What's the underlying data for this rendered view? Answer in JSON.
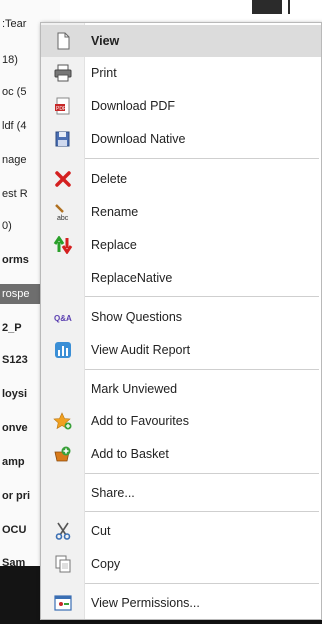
{
  "background": {
    "items": [
      {
        "text": ":Tear",
        "style": "normal"
      },
      {
        "text": "18)",
        "style": "normal"
      },
      {
        "text": "oc (5",
        "style": "normal"
      },
      {
        "text": "ldf (4",
        "style": "normal"
      },
      {
        "text": "nage",
        "style": "normal"
      },
      {
        "text": "est R",
        "style": "normal"
      },
      {
        "text": "0)",
        "style": "normal"
      },
      {
        "text": "orms",
        "style": "bold"
      },
      {
        "text": "rospe",
        "style": "selected"
      },
      {
        "text": "2_P",
        "style": "bold"
      },
      {
        "text": "S123",
        "style": "bold"
      },
      {
        "text": "loysi",
        "style": "bold"
      },
      {
        "text": "onve",
        "style": "bold"
      },
      {
        "text": "amp",
        "style": "bold"
      },
      {
        "text": "or pri",
        "style": "bold"
      },
      {
        "text": "OCU",
        "style": "bold"
      },
      {
        "text": "Sam",
        "style": "bold"
      }
    ]
  },
  "menu": {
    "items": [
      {
        "label": "View",
        "icon": "page-icon",
        "highlight": true
      },
      {
        "label": "Print",
        "icon": "printer-icon"
      },
      {
        "label": "Download PDF",
        "icon": "pdf-icon"
      },
      {
        "label": "Download Native",
        "icon": "save-icon"
      },
      {
        "label": "Delete",
        "icon": "delete-x-icon"
      },
      {
        "label": "Rename",
        "icon": "rename-abc-icon"
      },
      {
        "label": "Replace",
        "icon": "replace-arrows-icon"
      },
      {
        "label": "ReplaceNative",
        "icon": ""
      },
      {
        "label": "Show Questions",
        "icon": "qa-icon"
      },
      {
        "label": "View Audit Report",
        "icon": "audit-chart-icon"
      },
      {
        "label": "Mark Unviewed",
        "icon": ""
      },
      {
        "label": "Add to Favourites",
        "icon": "star-plus-icon"
      },
      {
        "label": "Add to Basket",
        "icon": "basket-plus-icon"
      },
      {
        "label": "Share...",
        "icon": ""
      },
      {
        "label": "Cut",
        "icon": "scissors-icon"
      },
      {
        "label": "Copy",
        "icon": "copy-icon"
      },
      {
        "label": "View Permissions...",
        "icon": "permissions-icon"
      }
    ]
  },
  "colors": {
    "delete": "#d42020",
    "replace_up": "#2aa02a",
    "replace_down": "#d42020",
    "audit": "#3b8fd6",
    "qa": "#5a3fb0"
  }
}
